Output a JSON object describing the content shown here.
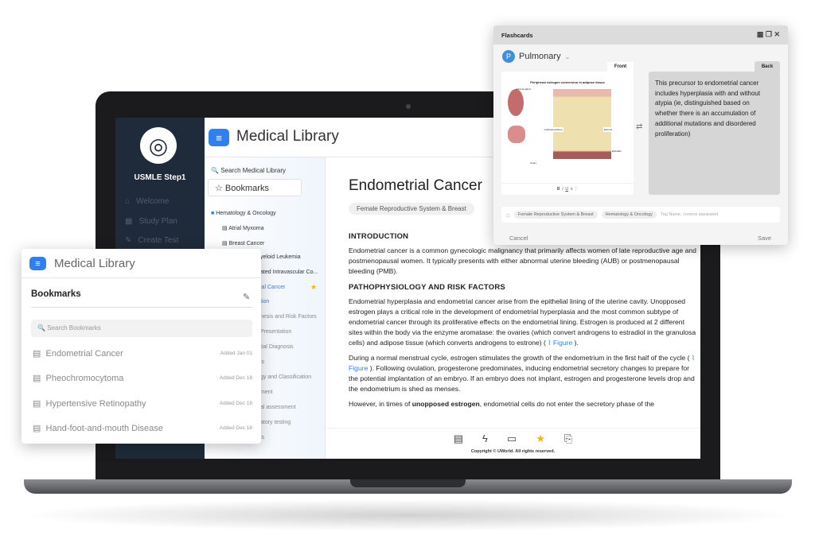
{
  "app": {
    "brand": "USMLE Step1",
    "title": "Medical Library"
  },
  "sidebar": {
    "items": [
      {
        "label": "Welcome",
        "icon": "home-icon"
      },
      {
        "label": "Study Plan",
        "icon": "calendar-icon"
      },
      {
        "label": "Create Test",
        "icon": "edit-icon"
      }
    ]
  },
  "library": {
    "search_label": "Search Medical Library",
    "bookmarks_label": "Bookmarks",
    "folder": "Hematology & Oncology",
    "items": [
      "Atrial Myxoma",
      "Breast Cancer",
      "yeloid Leukemia",
      "ated Intravascular Co...",
      "ial Cancer",
      "tion",
      "nesis and Risk Factors",
      "Presentation",
      "tial Diagnosis",
      "is",
      "gy and Classification",
      "ment",
      "al assessment",
      "atory testing",
      "is"
    ]
  },
  "article": {
    "title": "Endometrial Cancer",
    "chip": "Female Reproductive System & Breast",
    "h1": "INTRODUCTION",
    "p1": "Endometrial cancer is a common gynecologic malignancy that primarily affects women of late reproductive age and postmenopausal women.  It typically presents with either abnormal uterine bleeding (AUB) or postmenopausal bleeding (PMB).",
    "h2": "PATHOPHYSIOLOGY AND RISK FACTORS",
    "p2": "Endometrial hyperplasia and endometrial cancer arise from the epithelial lining of the uterine cavity.  Unopposed estrogen plays a critical role in the development of endometrial hyperplasia and the most common subtype of endometrial cancer through its proliferative effects on the endometrial lining.  Estrogen is produced at 2 different sites within the body via the enzyme aromatase: the ovaries (which convert androgens to estradiol in the granulosa cells) and adipose tissue (which converts androgens to estrone) (",
    "p2_end": ").",
    "figure_link": "Figure",
    "p3a": "During a normal menstrual cycle, estrogen stimulates the growth of the endometrium in the first half of the cycle (",
    "p3b": ").  Following ovulation, progesterone predominates, inducing endometrial secretory changes to prepare for the potential implantation of an embryo.  If an embryo does not implant, estrogen and progesterone levels drop and the endometrium is shed as menses.",
    "p4a": "However, in times of ",
    "p4b": "unopposed estrogen",
    "p4c": ", endometrial cells do not enter the secretory phase of the",
    "copyright": "Copyright © UWorld. All rights reserved."
  },
  "toolbar": [
    "notebook-icon",
    "flashcard-icon",
    "comment-icon",
    "star-icon",
    "search-document-icon"
  ],
  "bookmarks": {
    "header": "Medical Library",
    "title": "Bookmarks",
    "search_placeholder": "Search Bookmarks",
    "items": [
      {
        "name": "Endometrial Cancer",
        "date": "Added Jan 01"
      },
      {
        "name": "Pheochromocytoma",
        "date": "Added Dec 18"
      },
      {
        "name": "Hypertensive Retinopathy",
        "date": "Added Dec 18"
      },
      {
        "name": "Hand-foot-and-mouth Disease",
        "date": "Added Dec 18"
      }
    ]
  },
  "flashcards": {
    "title": "Flashcards",
    "deck": "Pulmonary",
    "deck_initial": "P",
    "front_label": "Front",
    "back_label": "Back",
    "figure_title": "Peripheral estrogen conversion in adipose tissue",
    "figure_labels": {
      "androstenedione": "Androstenedione",
      "estrone": "Estrone",
      "estradiol": "Estradiol",
      "adrenal": "Adrenal gland",
      "ovary": "Ovary"
    },
    "format_buttons": [
      "B",
      "I",
      "U"
    ],
    "back_text": "This precursor to endometrial cancer includes hyperplasia with and without atypia (ie, distinguished based on whether there is an accumulation of additional mutations and disordered proliferation)",
    "tags": [
      "Female Reproductive System & Breast",
      "Hematology & Oncology"
    ],
    "tag_placeholder": "Tag Name, comma separated",
    "cancel": "Cancel",
    "save": "Save"
  },
  "colors": {
    "accent": "#2f80ed",
    "sidebar": "#1f2b3a",
    "star": "#f5b400"
  }
}
